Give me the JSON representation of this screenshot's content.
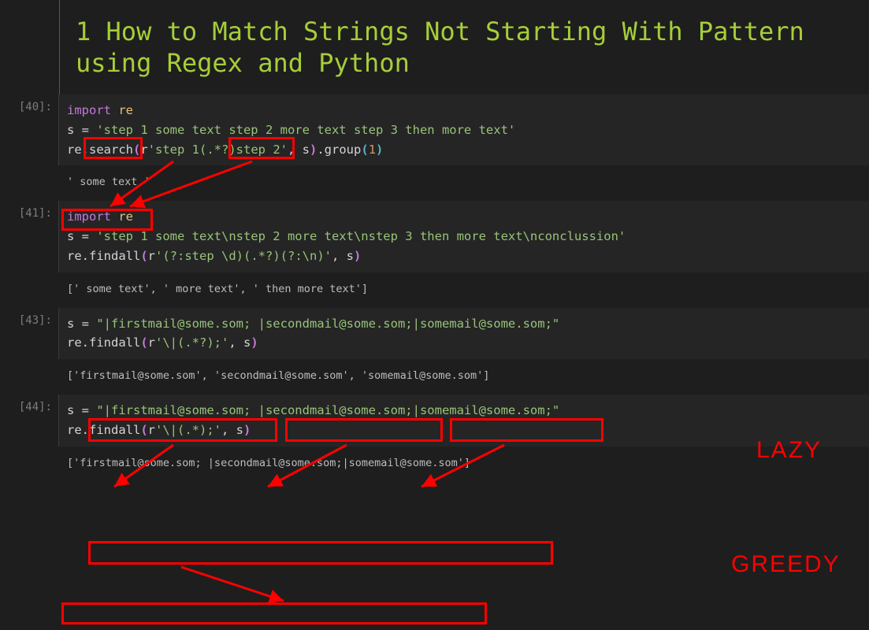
{
  "title": "1  How to Match Strings Not Starting With Pattern using Regex and Python",
  "cells": {
    "c40": {
      "prompt": "[40]:",
      "code": {
        "line1_import": "import",
        "line1_mod": "re",
        "line2_pre": "s ",
        "line2_eq": "= ",
        "line2_str": "'step 1 some text step 2 more text step 3 then more text'",
        "line3_a": "re.search",
        "line3_p1o": "(",
        "line3_r": "r",
        "line3_str": "'step 1(.*?)step 2'",
        "line3_c1": ", s",
        "line3_p1c": ")",
        "line3_grp": ".group",
        "line3_p2o": "(",
        "line3_num": "1",
        "line3_p2c": ")"
      },
      "output": "' some text '"
    },
    "c41": {
      "prompt": "[41]:",
      "code": {
        "l1i": "import",
        "l1m": "re",
        "l2a": "s ",
        "l2e": "= ",
        "l2s": "'step 1 some text\\nstep 2 more text\\nstep 3 then more text\\nconclussion'",
        "l3a": "re.findall",
        "l3po": "(",
        "l3r": "r",
        "l3s": "'(?:step \\d)(.*?)(?:\\n)'",
        "l3c": ", s",
        "l3pc": ")"
      },
      "output": "[' some text', ' more text', ' then more text']"
    },
    "c43": {
      "prompt": "[43]:",
      "code": {
        "l1a": "s ",
        "l1e": "= ",
        "l1s": "\"|firstmail@some.som; |secondmail@some.som;|somemail@some.som;\"",
        "l2a": "re.findall",
        "l2po": "(",
        "l2r": "r",
        "l2s": "'\\|(.*?);'",
        "l2c": ", s",
        "l2pc": ")"
      },
      "output": "['firstmail@some.som', 'secondmail@some.som', 'somemail@some.som']"
    },
    "c44": {
      "prompt": "[44]:",
      "code": {
        "l1a": "s ",
        "l1e": "= ",
        "l1s": "\"|firstmail@some.som; |secondmail@some.som;|somemail@some.som;\"",
        "l2a": "re.findall",
        "l2po": "(",
        "l2r": "r",
        "l2s": "'\\|(.*);'",
        "l2c": ", s",
        "l2pc": ")"
      },
      "output": "['firstmail@some.som; |secondmail@some.som;|somemail@some.som']"
    }
  },
  "annotations": {
    "lazy_label": "LAZY",
    "greedy_label": "GREEDY"
  }
}
